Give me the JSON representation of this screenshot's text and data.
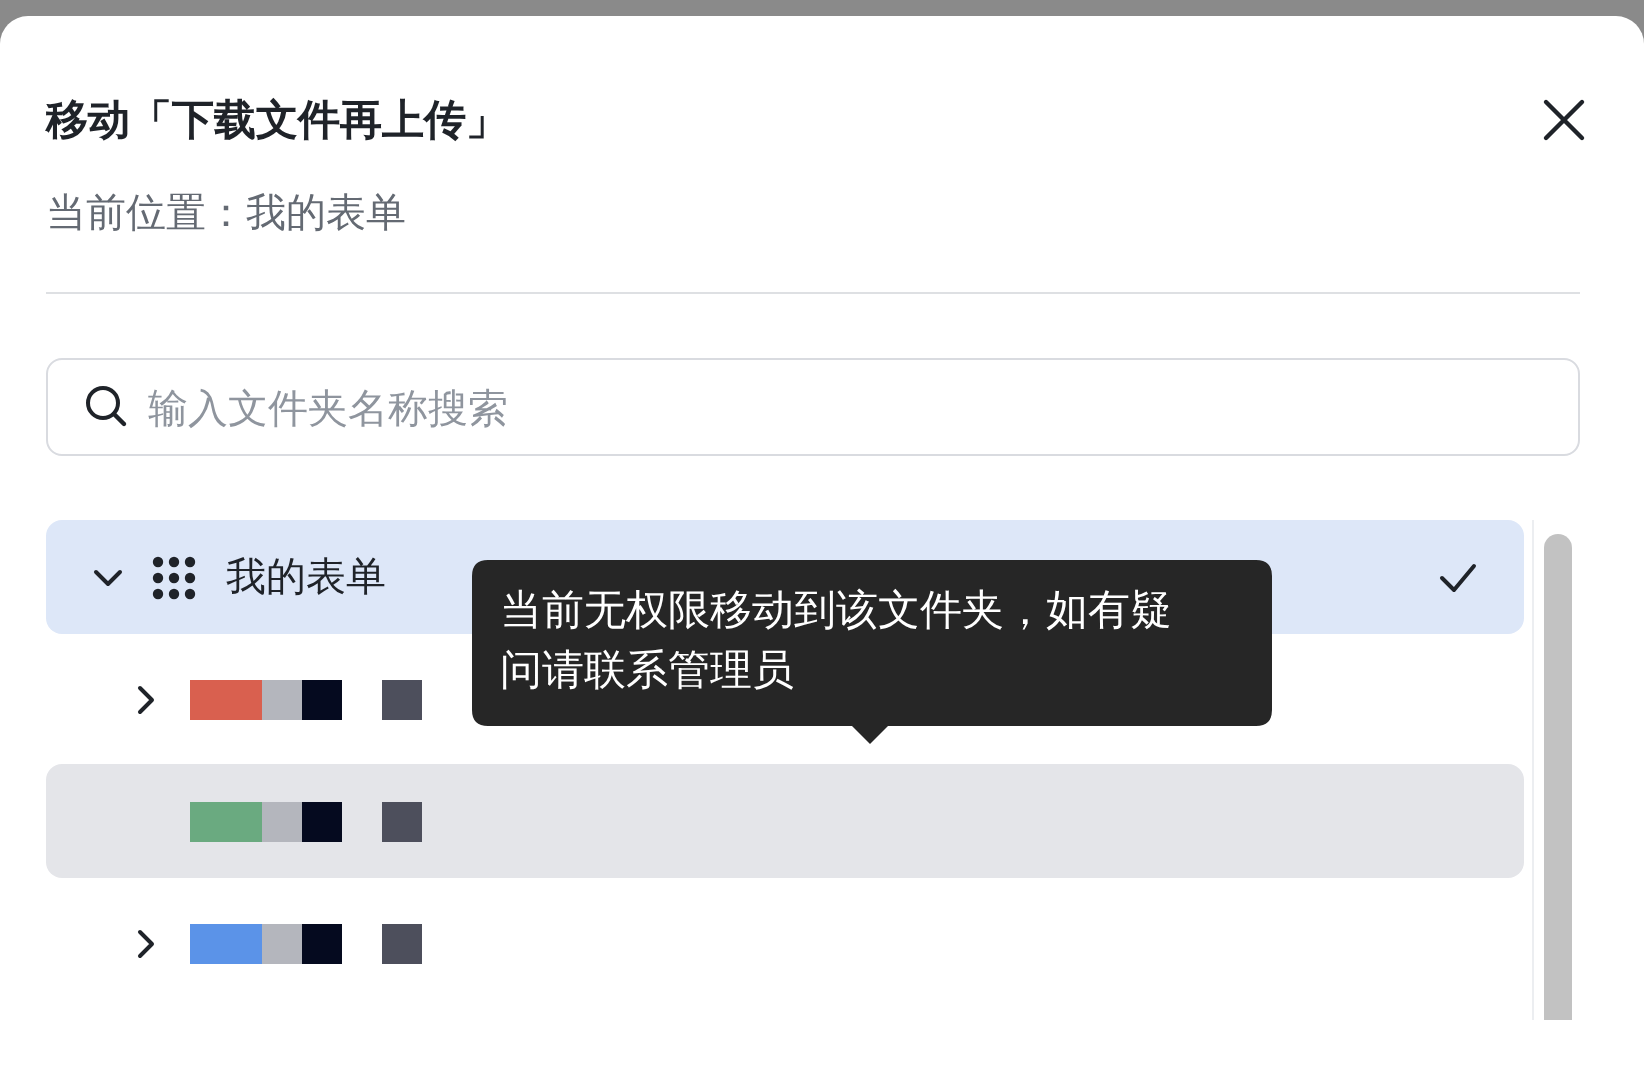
{
  "dialog": {
    "title": "移动「下载文件再上传」",
    "location": "当前位置：我的表单"
  },
  "search": {
    "placeholder": "输入文件夹名称搜索"
  },
  "tree": [
    {
      "label": "我的表单",
      "kind": "root",
      "expanded": true,
      "selected": true,
      "children": [
        {
          "kind": "redacted",
          "color": "#d9604f",
          "has_children": true,
          "hovered": false,
          "selected": false
        },
        {
          "kind": "redacted",
          "color": "#6aaa80",
          "has_children": false,
          "hovered": true,
          "selected": false
        },
        {
          "kind": "redacted",
          "color": "#5b93e8",
          "has_children": true,
          "hovered": false,
          "selected": false
        }
      ]
    }
  ],
  "tooltip": {
    "text": "当前无权限移动到该文件夹，如有疑问请联系管理员"
  }
}
